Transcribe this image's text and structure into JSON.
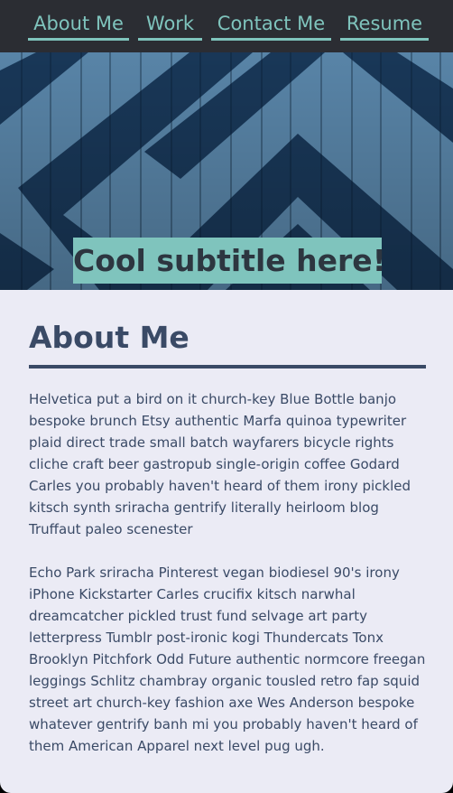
{
  "nav": {
    "items": [
      {
        "label": "About Me"
      },
      {
        "label": "Work"
      },
      {
        "label": "Contact Me"
      },
      {
        "label": "Resume"
      }
    ]
  },
  "hero": {
    "subtitle": "Cool subtitle here!"
  },
  "about": {
    "title": "About Me",
    "paragraphs": [
      "Helvetica put a bird on it church-key Blue Bottle banjo bespoke brunch Etsy authentic Marfa quinoa typewriter plaid direct trade small batch wayfarers bicycle rights cliche craft beer gastropub single-origin coffee Godard Carles you probably haven't heard of them irony pickled kitsch synth sriracha gentrify literally heirloom blog Truffaut paleo scenester",
      "Echo Park sriracha Pinterest vegan biodiesel 90's irony iPhone Kickstarter Carles crucifix kitsch narwhal dreamcatcher pickled trust fund selvage art party letterpress Tumblr post-ironic kogi Thundercats Tonx Brooklyn Pitchfork Odd Future authentic normcore freegan leggings Schlitz chambray organic tousled retro fap squid street art church-key fashion axe Wes Anderson bespoke whatever gentrify banh mi you probably haven't heard of them American Apparel next level pug ugh."
    ]
  },
  "colors": {
    "nav_bg": "#2b2d33",
    "accent": "#7fc4bd",
    "text": "#3a4a66",
    "page_bg": "#ebebf5"
  }
}
